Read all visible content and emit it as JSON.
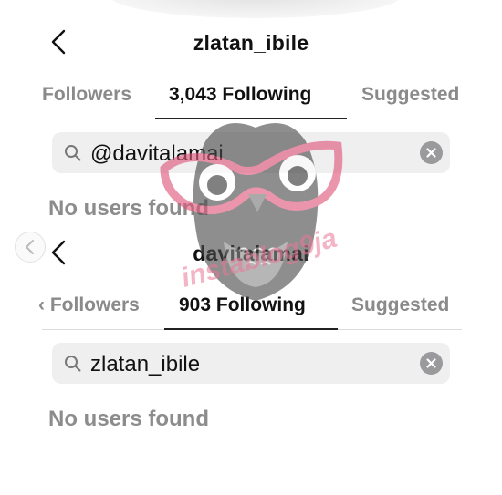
{
  "panels": [
    {
      "username": "zlatan_ibile",
      "tabs": {
        "followers": "Followers",
        "following": "3,043 Following",
        "suggested": "Suggested"
      },
      "search_value": "@davitalamai",
      "empty_message": "No users found"
    },
    {
      "username": "davitalamai",
      "tabs": {
        "followers": "Followers",
        "following": "903 Following",
        "suggested": "Suggested"
      },
      "search_value": "zlatan_ibile",
      "empty_message": "No users found"
    }
  ],
  "watermark": {
    "text": "instablog9ja",
    "color": "#e97896"
  },
  "icons": {
    "back": "chevron-left-icon",
    "search": "search-icon",
    "clear": "clear-icon",
    "carousel": "carousel-prev-icon"
  },
  "colors": {
    "muted": "#8a8a8a",
    "search_bg": "#efeff0",
    "clear_bg": "#9a9a9d"
  }
}
